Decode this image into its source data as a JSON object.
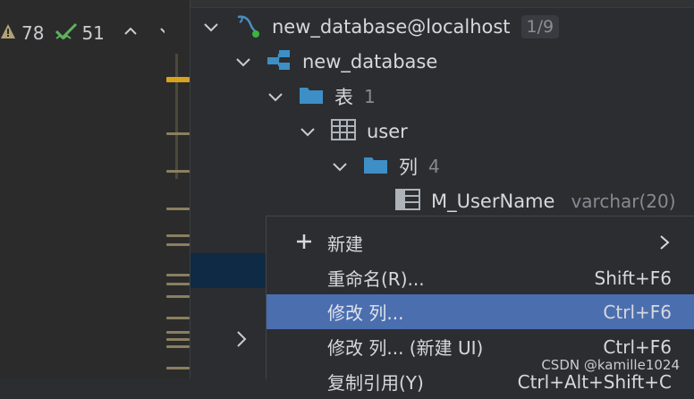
{
  "inspections": {
    "warnings_count": "78",
    "checks_count": "51"
  },
  "tree": {
    "connection": {
      "label": "new_database@localhost",
      "badge": "1/9"
    },
    "database": {
      "label": "new_database"
    },
    "tables_folder": {
      "label": "表",
      "count": "1"
    },
    "table": {
      "label": "user"
    },
    "columns_folder": {
      "label": "列",
      "count": "4"
    },
    "column": {
      "label": "M_UserName",
      "type": "varchar(20)"
    }
  },
  "context_menu": {
    "items": [
      {
        "label": "新建",
        "shortcut": ""
      },
      {
        "label": "重命名(R)...",
        "shortcut": "Shift+F6"
      },
      {
        "label": "修改 列...",
        "shortcut": "Ctrl+F6"
      },
      {
        "label": "修改 列... (新建 UI)",
        "shortcut": "Ctrl+F6"
      },
      {
        "label": "复制引用(Y)",
        "shortcut": "Ctrl+Alt+Shift+C"
      }
    ]
  },
  "watermark": "CSDN @kamille1024",
  "colors": {
    "accent_selection": "#4b6eaf",
    "folder_blue": "#3d8fc6",
    "warning_yellow": "#d8a21f"
  }
}
